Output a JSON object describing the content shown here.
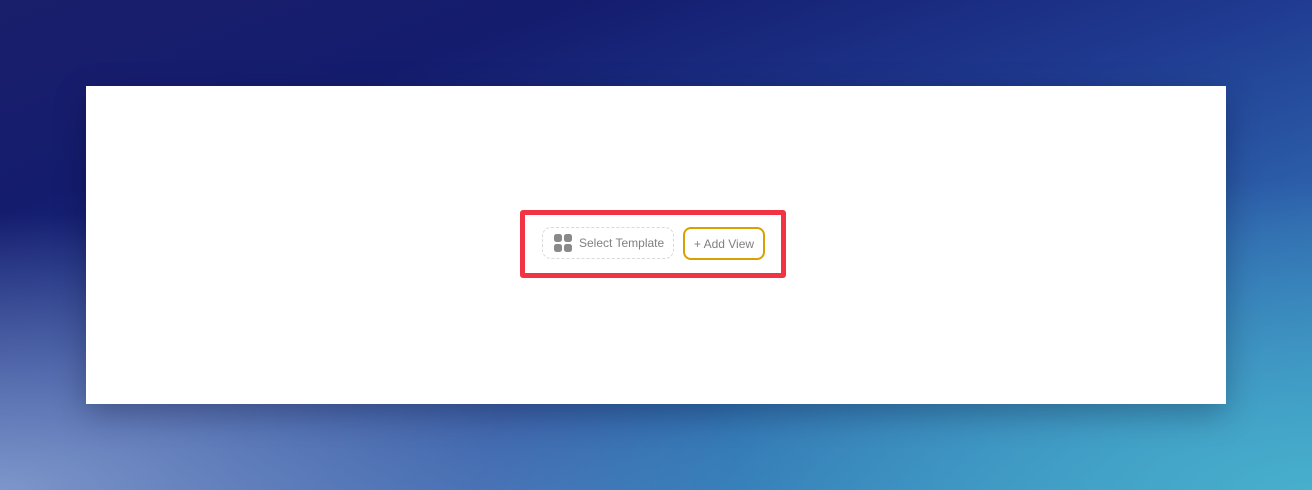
{
  "toolbar": {
    "select_template_label": "Select Template",
    "select_template_icon": "grid-icon",
    "add_view_label": "+ Add View"
  },
  "colors": {
    "highlight_border": "#f23344",
    "add_view_border": "#d9a000",
    "dashed_border": "#d9d9d9",
    "label_text": "#808080",
    "card_background": "#ffffff"
  }
}
